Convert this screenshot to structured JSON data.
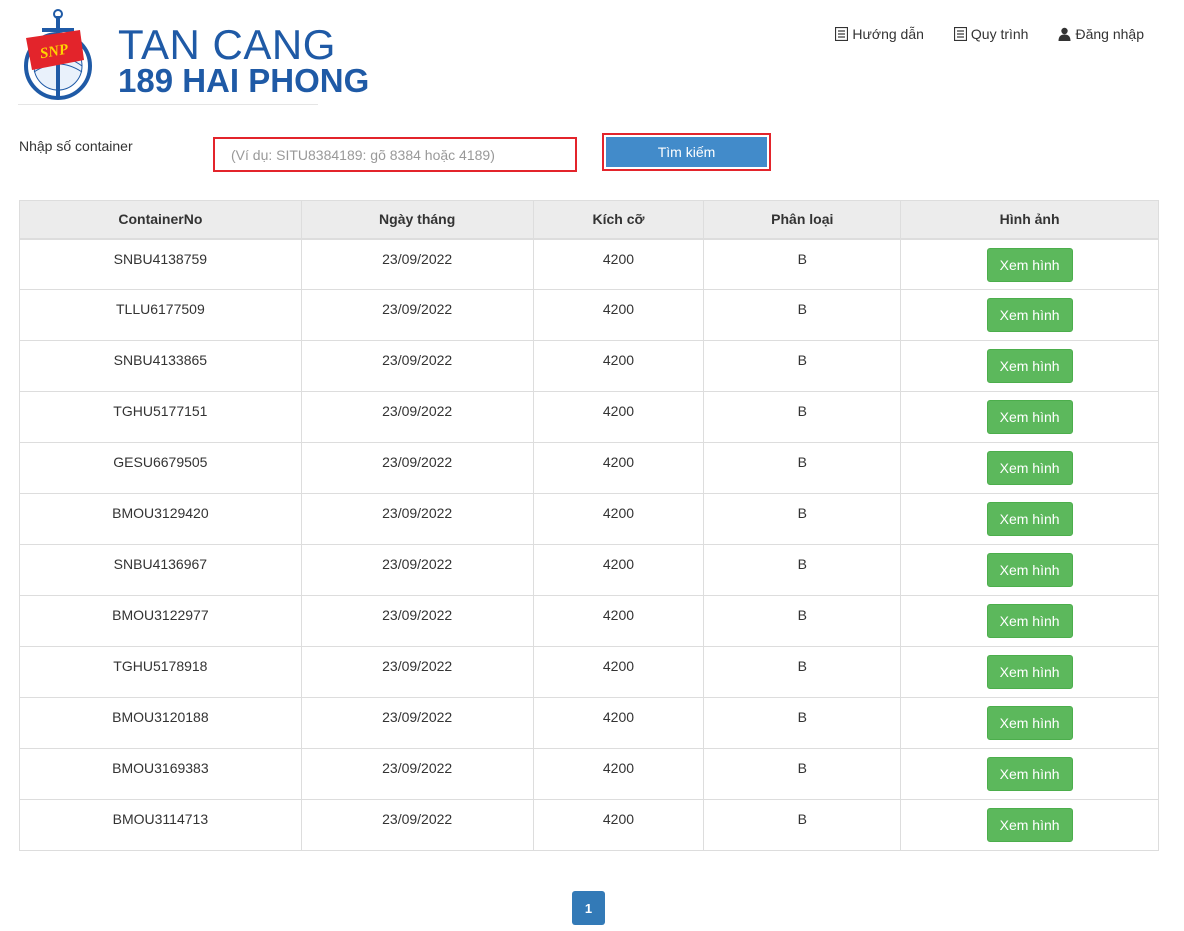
{
  "brand": {
    "line1": "TAN CANG",
    "line2": "189 HAI PHONG",
    "badge": "SNP",
    "primary_color": "#1f5aa6",
    "flag_color": "#e3242b"
  },
  "nav": {
    "items": [
      {
        "label": "Hướng dẫn",
        "icon": "list-icon"
      },
      {
        "label": "Quy trình",
        "icon": "list-icon"
      },
      {
        "label": "Đăng nhập",
        "icon": "user-icon"
      }
    ]
  },
  "search": {
    "label": "Nhập số container",
    "placeholder": "(Ví dụ: SITU8384189: gõ 8384 hoặc 4189)",
    "value": "",
    "button_label": "Tìm kiếm"
  },
  "table": {
    "headers": [
      "ContainerNo",
      "Ngày tháng",
      "Kích cỡ",
      "Phân loại",
      "Hình ảnh"
    ],
    "action_label": "Xem hình",
    "rows": [
      {
        "container": "SNBU4138759",
        "date": "23/09/2022",
        "size": "4200",
        "type": "B"
      },
      {
        "container": "TLLU6177509",
        "date": "23/09/2022",
        "size": "4200",
        "type": "B"
      },
      {
        "container": "SNBU4133865",
        "date": "23/09/2022",
        "size": "4200",
        "type": "B"
      },
      {
        "container": "TGHU5177151",
        "date": "23/09/2022",
        "size": "4200",
        "type": "B"
      },
      {
        "container": "GESU6679505",
        "date": "23/09/2022",
        "size": "4200",
        "type": "B"
      },
      {
        "container": "BMOU3129420",
        "date": "23/09/2022",
        "size": "4200",
        "type": "B"
      },
      {
        "container": "SNBU4136967",
        "date": "23/09/2022",
        "size": "4200",
        "type": "B"
      },
      {
        "container": "BMOU3122977",
        "date": "23/09/2022",
        "size": "4200",
        "type": "B"
      },
      {
        "container": "TGHU5178918",
        "date": "23/09/2022",
        "size": "4200",
        "type": "B"
      },
      {
        "container": "BMOU3120188",
        "date": "23/09/2022",
        "size": "4200",
        "type": "B"
      },
      {
        "container": "BMOU3169383",
        "date": "23/09/2022",
        "size": "4200",
        "type": "B"
      },
      {
        "container": "BMOU3114713",
        "date": "23/09/2022",
        "size": "4200",
        "type": "B"
      }
    ]
  },
  "pagination": {
    "current_page": "1"
  }
}
